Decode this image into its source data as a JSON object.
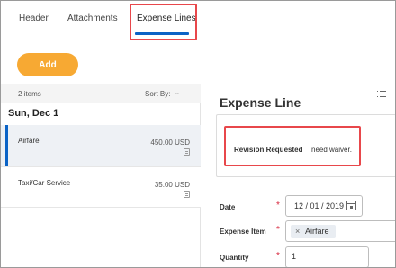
{
  "tabs": [
    {
      "label": "Header"
    },
    {
      "label": "Attachments"
    },
    {
      "label": "Expense Lines",
      "selected": true
    }
  ],
  "add_button": {
    "label": "Add"
  },
  "list": {
    "count_label": "2 items",
    "sort_label": "Sort By:",
    "group_label": "Sun, Dec 1",
    "items": [
      {
        "name": "Airfare",
        "amount": "450.00 USD",
        "selected": true
      },
      {
        "name": "Taxi/Car Service",
        "amount": "35.00 USD",
        "selected": false
      }
    ]
  },
  "detail": {
    "title": "Expense Line",
    "revision": {
      "label": "Revision Requested",
      "comment": "need waiver."
    },
    "fields": {
      "date": {
        "label": "Date",
        "value": "12 / 01 / 2019",
        "required": true
      },
      "expense_item": {
        "label": "Expense Item",
        "value": "Airfare",
        "required": true
      },
      "quantity": {
        "label": "Quantity",
        "value": "1",
        "required": true
      }
    }
  },
  "colors": {
    "accent": "#0b63c6",
    "add_button": "#f7a933",
    "highlight": "#e8474b",
    "required": "#d7263d"
  },
  "icons": [
    "chevron-down-icon",
    "receipt-icon",
    "calendar-icon",
    "remove-icon",
    "list-icon"
  ]
}
